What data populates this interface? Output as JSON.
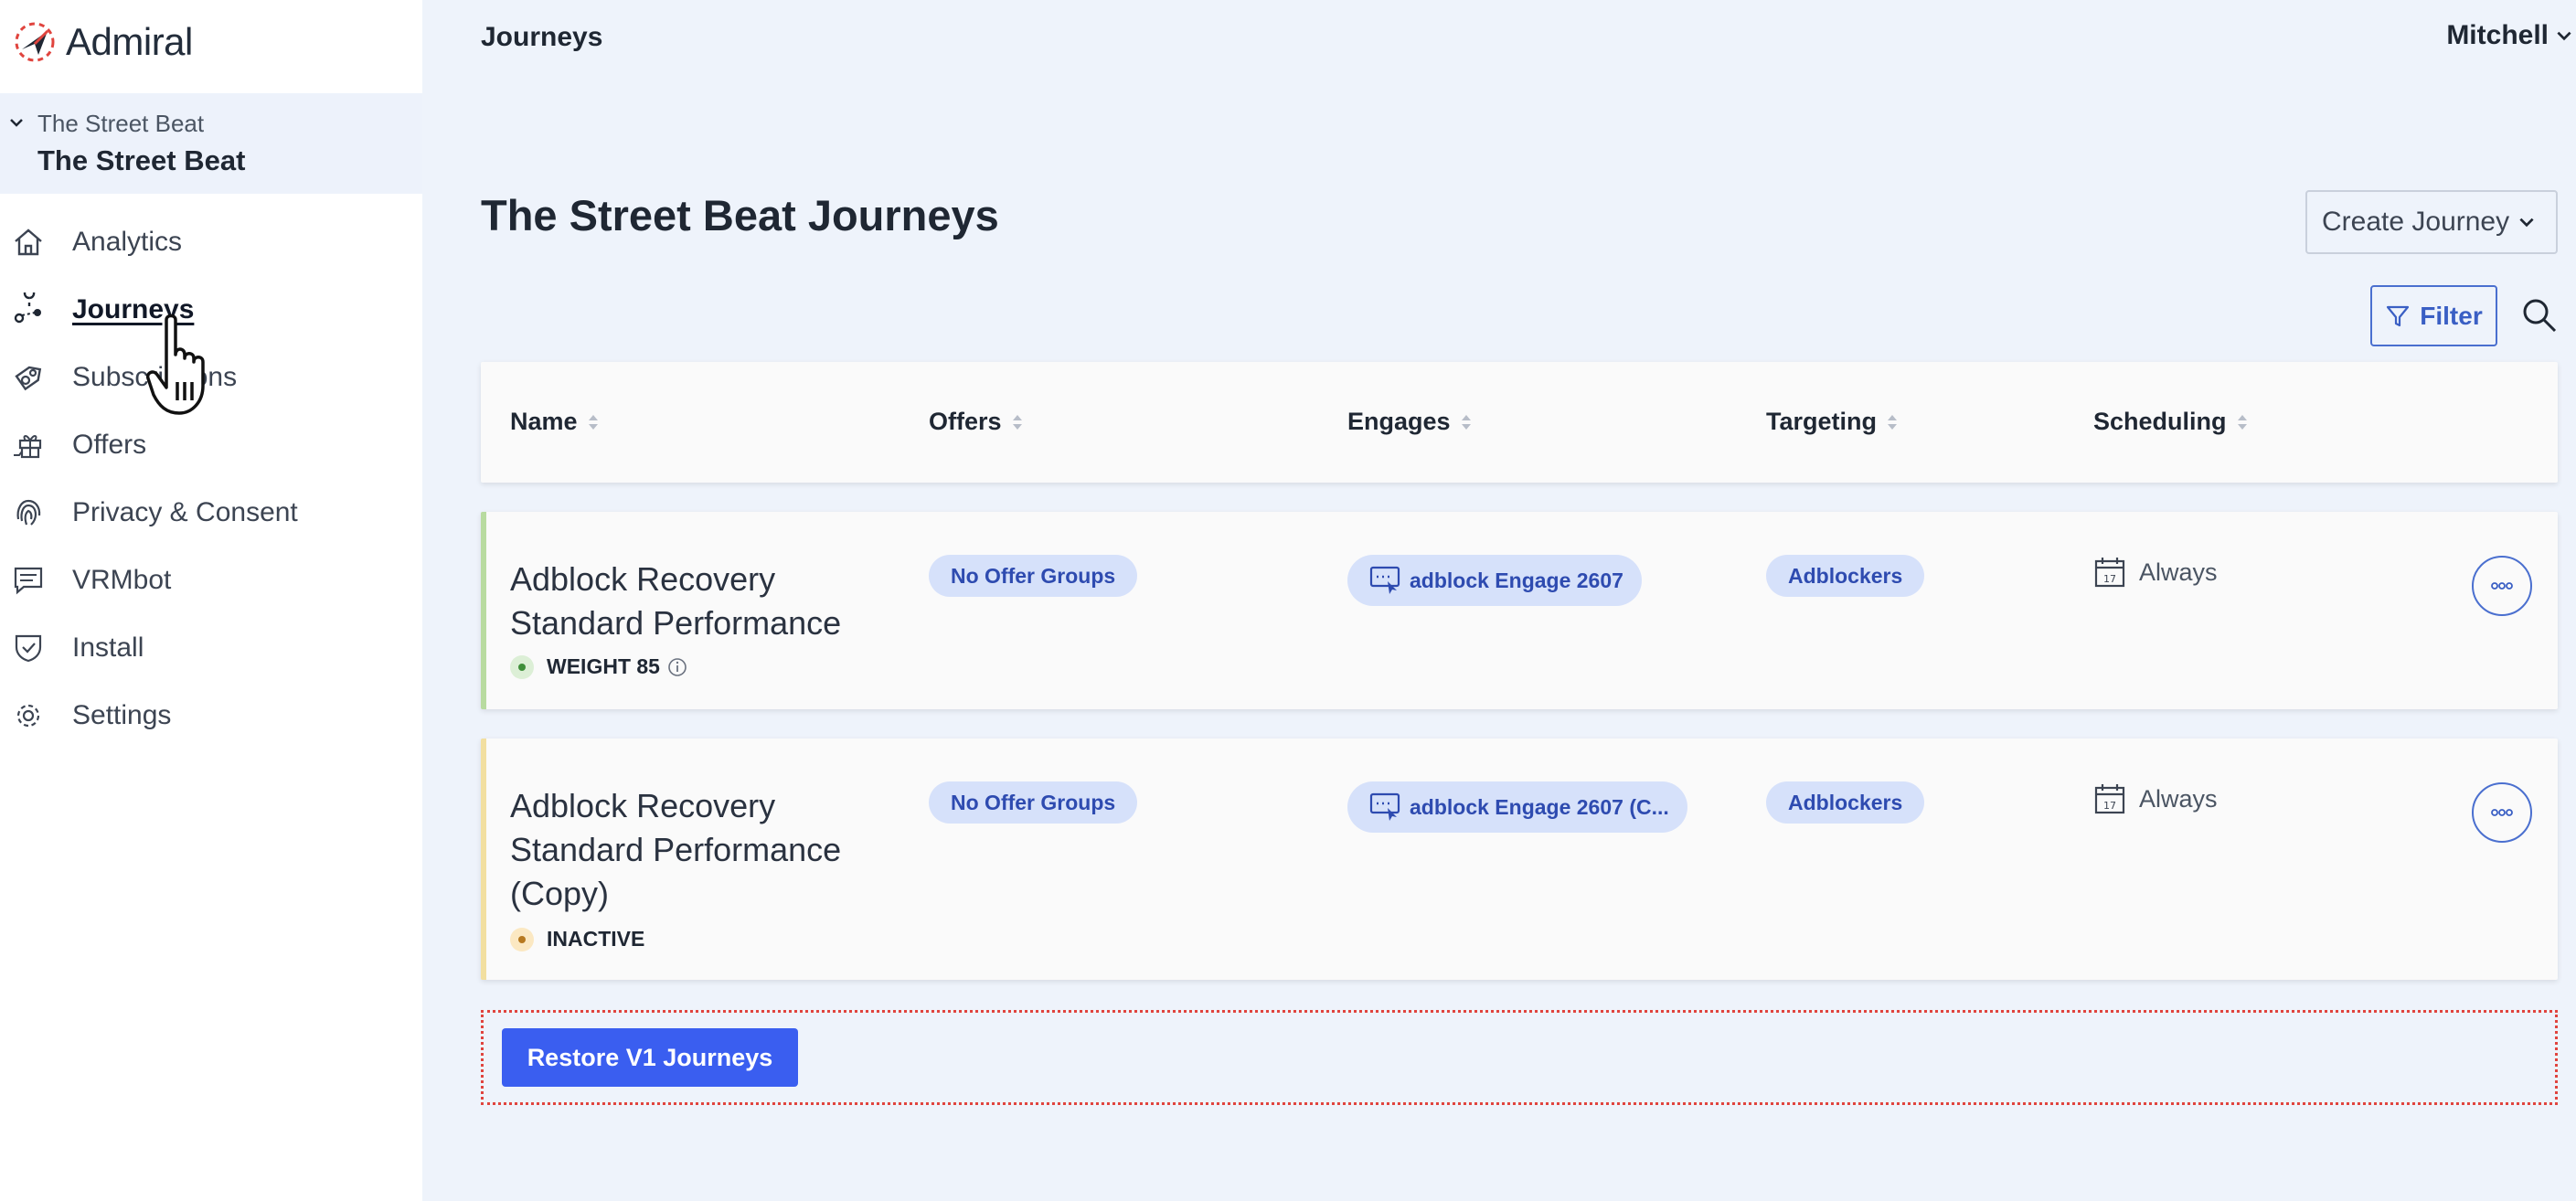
{
  "app": {
    "name": "Admiral"
  },
  "site": {
    "parent": "The Street Beat",
    "current": "The Street Beat"
  },
  "sidebar": {
    "items": [
      {
        "label": "Analytics",
        "icon": "home-icon"
      },
      {
        "label": "Journeys",
        "icon": "journeys-icon",
        "active": true
      },
      {
        "label": "Subscriptions",
        "icon": "subscriptions-icon"
      },
      {
        "label": "Offers",
        "icon": "gift-icon"
      },
      {
        "label": "Privacy & Consent",
        "icon": "fingerprint-icon"
      },
      {
        "label": "VRMbot",
        "icon": "chat-icon"
      },
      {
        "label": "Install",
        "icon": "shield-icon"
      },
      {
        "label": "Settings",
        "icon": "gear-icon"
      }
    ]
  },
  "header": {
    "section": "Journeys",
    "user": "Mitchell"
  },
  "page": {
    "title": "The Street Beat Journeys",
    "create_label": "Create Journey",
    "filter_label": "Filter"
  },
  "table": {
    "columns": [
      "Name",
      "Offers",
      "Engages",
      "Targeting",
      "Scheduling"
    ],
    "rows": [
      {
        "name": "Adblock Recovery Standard Performance",
        "status": "WEIGHT 85",
        "status_color": "#4caf50",
        "offers": "No Offer Groups",
        "engage": "adblock Engage 2607",
        "targeting": "Adblockers",
        "scheduling": "Always"
      },
      {
        "name": "Adblock Recovery Standard Performance (Copy)",
        "status": "INACTIVE",
        "status_color": "#e0a82e",
        "offers": "No Offer Groups",
        "engage": "adblock Engage 2607 (C...",
        "targeting": "Adblockers",
        "scheduling": "Always"
      }
    ]
  },
  "restore": {
    "label": "Restore V1 Journeys"
  },
  "colors": {
    "accent": "#3a5ef0",
    "pill_bg": "#d6e1fa",
    "pill_text": "#2e4bb0"
  }
}
